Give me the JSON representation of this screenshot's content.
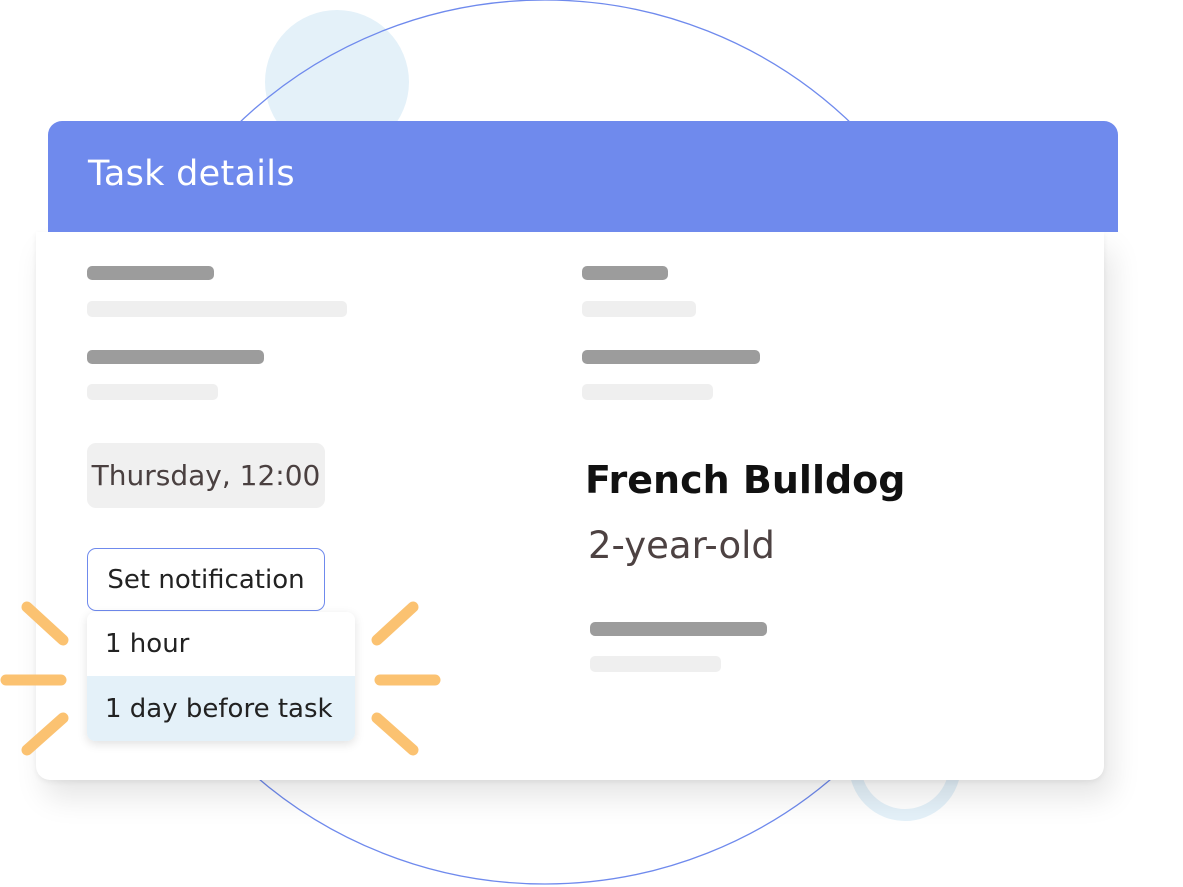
{
  "header": {
    "title": "Task details"
  },
  "task": {
    "date_time": "Thursday, 12:00",
    "notification_button_label": "Set notification",
    "notification_options": [
      {
        "label": "1 hour",
        "selected": false
      },
      {
        "label": "1 day before task",
        "selected": true
      }
    ]
  },
  "pet": {
    "name": "French Bulldog",
    "age": "2-year-old"
  },
  "colors": {
    "header": "#6f8aed",
    "accent_border": "#6f8aed",
    "selected_option": "#e4f1f9",
    "highlight_rays": "#fbc271",
    "background_circle": "#e4f1f9",
    "placeholder_dark": "#9c9c9c",
    "placeholder_light": "#efefef"
  },
  "icons": [
    "highlight-burst-icon"
  ]
}
